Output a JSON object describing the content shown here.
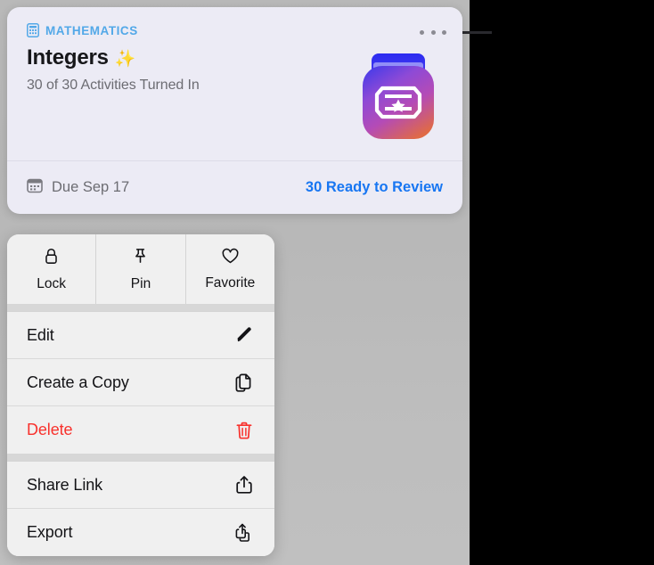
{
  "card": {
    "subject": "MATHEMATICS",
    "subject_icon": "calculator-icon",
    "title": "Integers",
    "title_emoji": "✨",
    "subtitle": "30 of 30 Activities Turned In",
    "more_icon": "ellipsis-icon",
    "app_icon": "assignment-app-icon",
    "due_icon": "calendar-icon",
    "due_text": "Due Sep 17",
    "review_link": "30 Ready to Review",
    "colors": {
      "background": "#ecebf5",
      "subject": "#52a8e8",
      "link": "#1776f2",
      "title": "#17171a",
      "subtitle": "#6c6c72"
    }
  },
  "context_menu": {
    "segmented": [
      {
        "label": "Lock",
        "icon": "lock-icon"
      },
      {
        "label": "Pin",
        "icon": "pin-icon"
      },
      {
        "label": "Favorite",
        "icon": "heart-icon"
      }
    ],
    "groups": [
      {
        "items": [
          {
            "label": "Edit",
            "icon": "pencil-icon",
            "destructive": false
          },
          {
            "label": "Create a Copy",
            "icon": "duplicate-icon",
            "destructive": false
          },
          {
            "label": "Delete",
            "icon": "trash-icon",
            "destructive": true
          }
        ]
      },
      {
        "items": [
          {
            "label": "Share Link",
            "icon": "share-icon",
            "destructive": false
          },
          {
            "label": "Export",
            "icon": "export-icon",
            "destructive": false
          }
        ]
      }
    ],
    "colors": {
      "background": "#f0f0f0",
      "destructive": "#f8312c",
      "label": "#131316"
    }
  }
}
